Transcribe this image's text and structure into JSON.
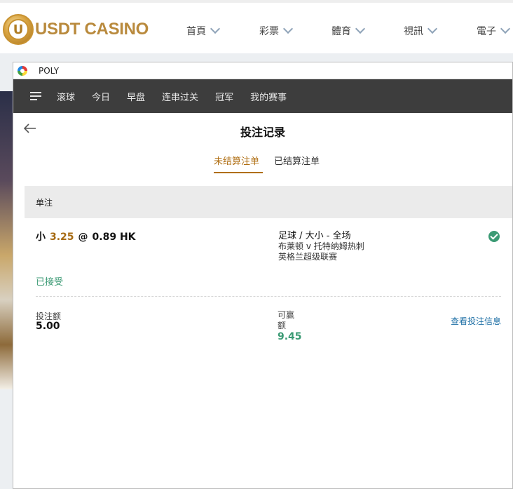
{
  "site": {
    "logo_letter": "U",
    "logo_text": "USDT CASINO",
    "nav": [
      "首頁",
      "彩票",
      "體育",
      "視訊",
      "電子"
    ]
  },
  "window": {
    "title": "POLY"
  },
  "sport_nav": {
    "tabs": [
      "滚球",
      "今日",
      "早盘",
      "连串过关",
      "冠军",
      "我的赛事"
    ]
  },
  "page": {
    "title": "投注记录",
    "tabs": [
      {
        "label": "未结算注单",
        "active": true
      },
      {
        "label": "已结算注单",
        "active": false
      }
    ],
    "section_title": "单注"
  },
  "bet": {
    "selection": "小",
    "handicap": "3.25",
    "at": "@",
    "odds": "0.89 HK",
    "market": "足球 / 大小 - 全场",
    "match": "布莱顿 v 托特纳姆热刺",
    "league": "英格兰超级联赛",
    "status": "已接受",
    "stake_label": "投注额",
    "stake": "5.00",
    "win_label": "可赢额",
    "win": "9.45",
    "view_link": "查看投注信息"
  },
  "colors": {
    "accent": "#b06f14",
    "success": "#3b9a74",
    "nav_bg": "#3d3d3d",
    "link": "#1d6fa5"
  }
}
